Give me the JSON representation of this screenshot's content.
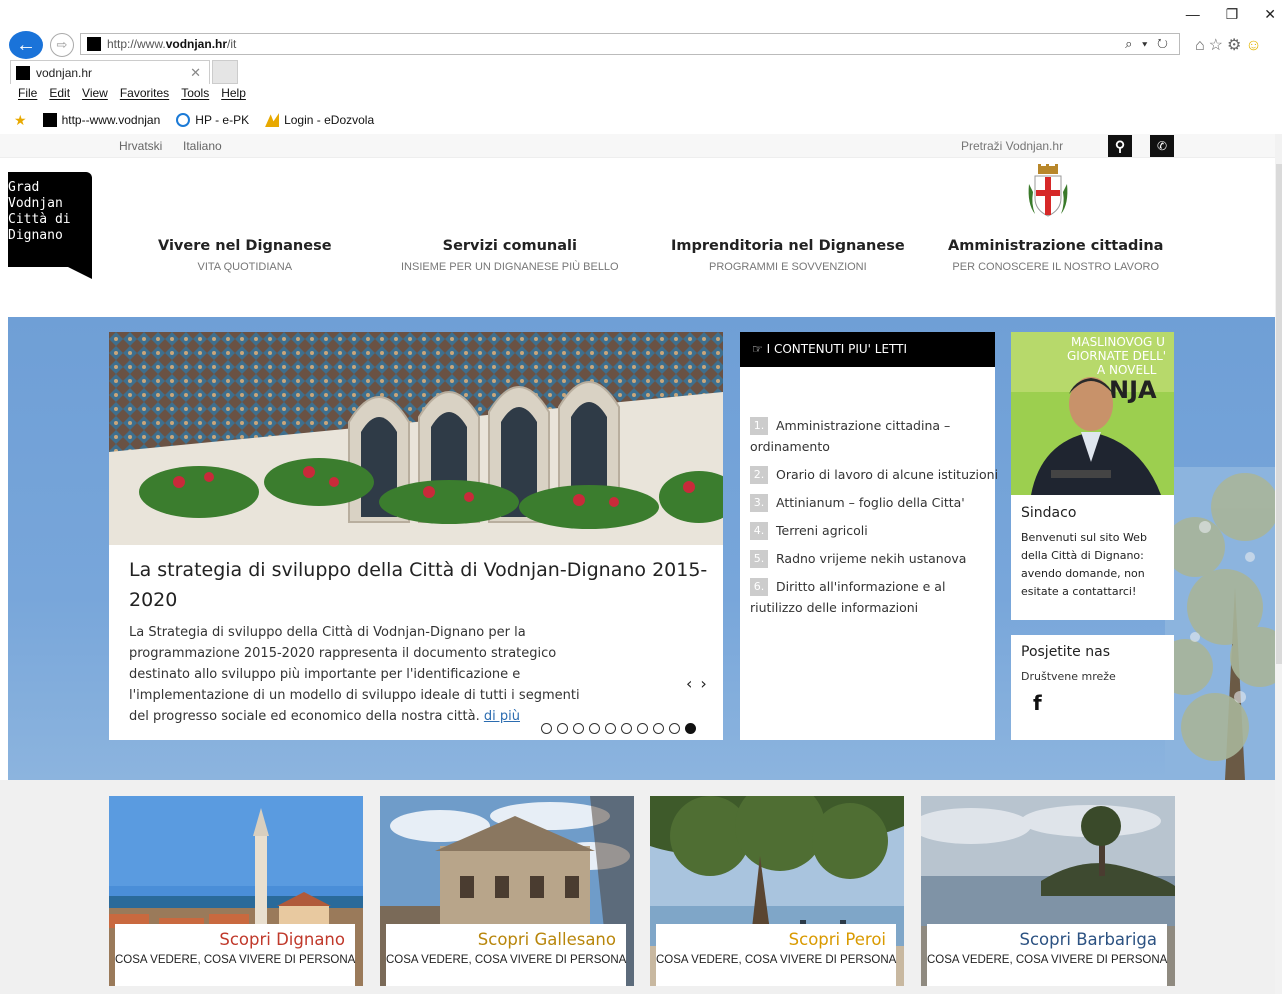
{
  "browser": {
    "window_controls": [
      "—",
      "❐",
      "✕"
    ],
    "address": {
      "prefix": "http://www.",
      "domain": "vodnjan.hr",
      "path": "/it",
      "tools": "⌕ ▾ ↻"
    },
    "right_icons": "⌂☆⚙",
    "tab": {
      "title": "vodnjan.hr",
      "close": "✕"
    },
    "menu": [
      "File",
      "Edit",
      "View",
      "Favorites",
      "Tools",
      "Help"
    ],
    "favorites": [
      {
        "label": "http--www.vodnjan",
        "icon": "black-square-icon"
      },
      {
        "label": "HP - e-PK",
        "icon": "ie-icon"
      },
      {
        "label": "Login - eDozvola",
        "icon": "edozvola-icon"
      }
    ]
  },
  "site": {
    "languages": [
      "Hrvatski",
      "Italiano"
    ],
    "search": {
      "placeholder": "Pretraži Vodnjan.hr"
    },
    "logo": [
      "Grad",
      "Vodnjan",
      "Città di",
      "Dignano"
    ],
    "nav": [
      {
        "title": "Vivere nel Dignanese",
        "subtitle": "VITA QUOTIDIANA"
      },
      {
        "title": "Servizi comunali",
        "subtitle": "INSIEME PER UN DIGNANESE PIÙ BELLO"
      },
      {
        "title": "Imprenditoria nel Dignanese",
        "subtitle": "PROGRAMMI E SOVVENZIONI"
      },
      {
        "title": "Amministrazione cittadina",
        "subtitle": "PER CONOSCERE IL NOSTRO LAVORO"
      }
    ],
    "slider": {
      "title": "La strategia di sviluppo della Città di Vodnjan-Dignano 2015-2020",
      "text": "La Strategia di sviluppo della Città di Vodnjan-Dignano per la programmazione 2015-2020 rappresenta il documento strategico destinato allo sviluppo più importante per l'identificazione e l'implementazione di un modello di sviluppo ideale di tutti i segmenti del progresso sociale ed economico della nostra città.",
      "more": "di più",
      "arrows": {
        "prev": "‹",
        "next": "›"
      },
      "dot_count": 10,
      "active_dot": 10
    },
    "most_read": {
      "title": "I CONTENUTI PIU' LETTI",
      "items": [
        {
          "n": "1.",
          "text": "Amministrazione cittadina – ordinamento"
        },
        {
          "n": "2.",
          "text": "Orario di lavoro di alcune istituzioni"
        },
        {
          "n": "3.",
          "text": "Attinianum – foglio della Citta'"
        },
        {
          "n": "4.",
          "text": "Terreni agricoli"
        },
        {
          "n": "5.",
          "text": "Radno vrijeme nekih ustanova"
        },
        {
          "n": "6.",
          "text": "Diritto all'informazione e al riutilizzo delle informazioni"
        }
      ]
    },
    "mayor": {
      "title": "Sindaco",
      "text": "Benvenuti sul sito Web della Città di Dignano: avendo domande, non esitate a contattarci!",
      "photo_banner": [
        "MASLINOVOG U",
        "GIORNATE DELL'",
        "A NOVELL",
        "NJA"
      ]
    },
    "visit": {
      "title": "Posjetite nas",
      "subtitle": "Društvene mreže",
      "icon": "f"
    },
    "cards": [
      {
        "title": "Scopri Dignano",
        "subtitle": "COSA VEDERE, COSA VIVERE DI PERSONA",
        "color": "#c0392b"
      },
      {
        "title": "Scopri Gallesano",
        "subtitle": "COSA VEDERE, COSA VIVERE DI PERSONA",
        "color": "#b8860b"
      },
      {
        "title": "Scopri Peroi",
        "subtitle": "COSA VEDERE, COSA VIVERE DI PERSONA",
        "color": "#d99a00"
      },
      {
        "title": "Scopri Barbariga",
        "subtitle": "COSA VEDERE, COSA VIVERE DI PERSONA",
        "color": "#2c5282"
      }
    ]
  }
}
